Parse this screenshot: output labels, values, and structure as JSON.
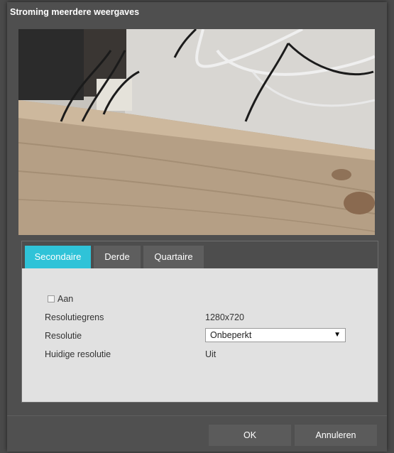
{
  "dialog": {
    "title": "Stroming meerdere weergaves"
  },
  "tabs": [
    {
      "label": "Secondaire",
      "active": true
    },
    {
      "label": "Derde",
      "active": false
    },
    {
      "label": "Quartaire",
      "active": false
    }
  ],
  "form": {
    "enabled_label": "Aan",
    "enabled_checked": false,
    "resolution_limit_label": "Resolutiegrens",
    "resolution_limit_value": "1280x720",
    "resolution_label": "Resolutie",
    "resolution_selected": "Onbeperkt",
    "current_resolution_label": "Huidige resolutie",
    "current_resolution_value": "Uit"
  },
  "buttons": {
    "ok_label": "OK",
    "cancel_label": "Annuleren"
  },
  "colors": {
    "active_tab": "#2fc3d8",
    "dialog_bg": "#4f4f4f",
    "content_bg": "#e1e1e1"
  },
  "icons": {
    "dropdown": "chevron-down-icon",
    "checkbox": "checkbox-icon"
  }
}
